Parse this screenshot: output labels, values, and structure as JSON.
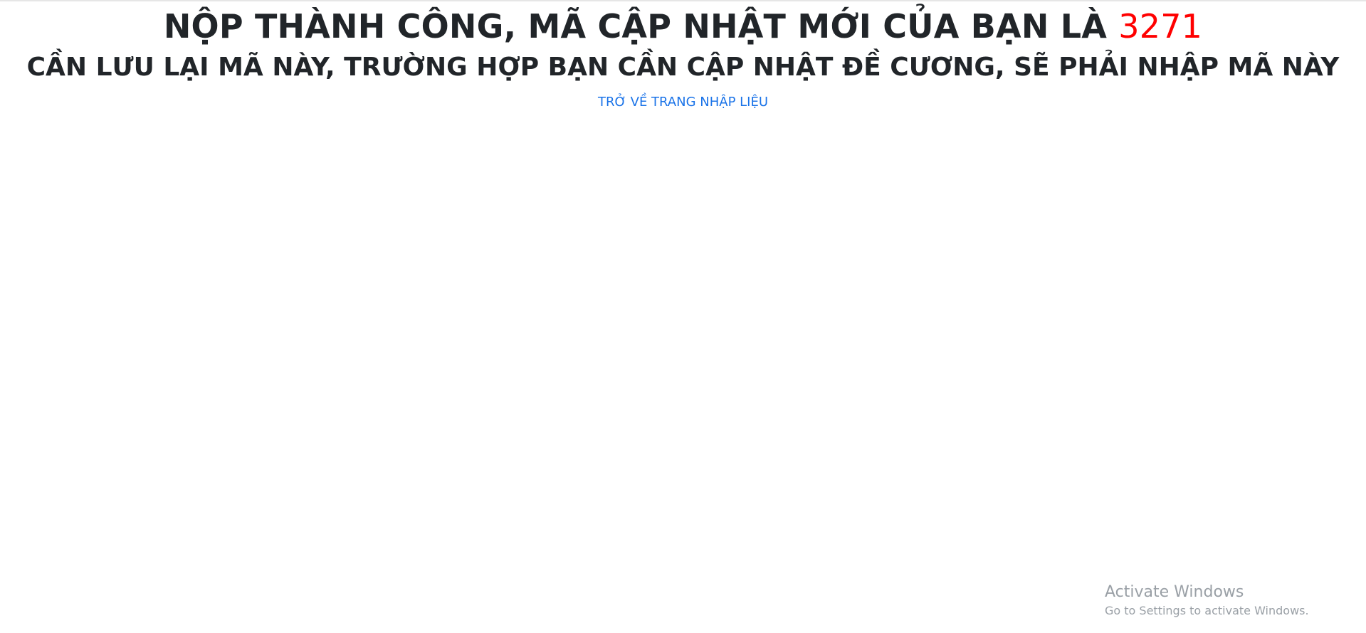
{
  "message": {
    "headline_prefix": "NỘP THÀNH CÔNG, MÃ CẬP NHẬT MỚI CỦA BẠN LÀ ",
    "update_code": "3271",
    "subheadline": "CẦN LƯU LẠI MÃ NÀY, TRƯỜNG HỢP BẠN CẦN CẬP NHẬT ĐỀ CƯƠNG, SẼ PHẢI NHẬP MÃ NÀY"
  },
  "link": {
    "back_label": "TRỞ VỀ TRANG NHẬP LIỆU"
  },
  "watermark": {
    "title": "Activate Windows",
    "subtitle": "Go to Settings to activate Windows."
  },
  "colors": {
    "text": "#212529",
    "code": "#ff0000",
    "link": "#1a73e8",
    "watermark": "#9aa0a6"
  }
}
